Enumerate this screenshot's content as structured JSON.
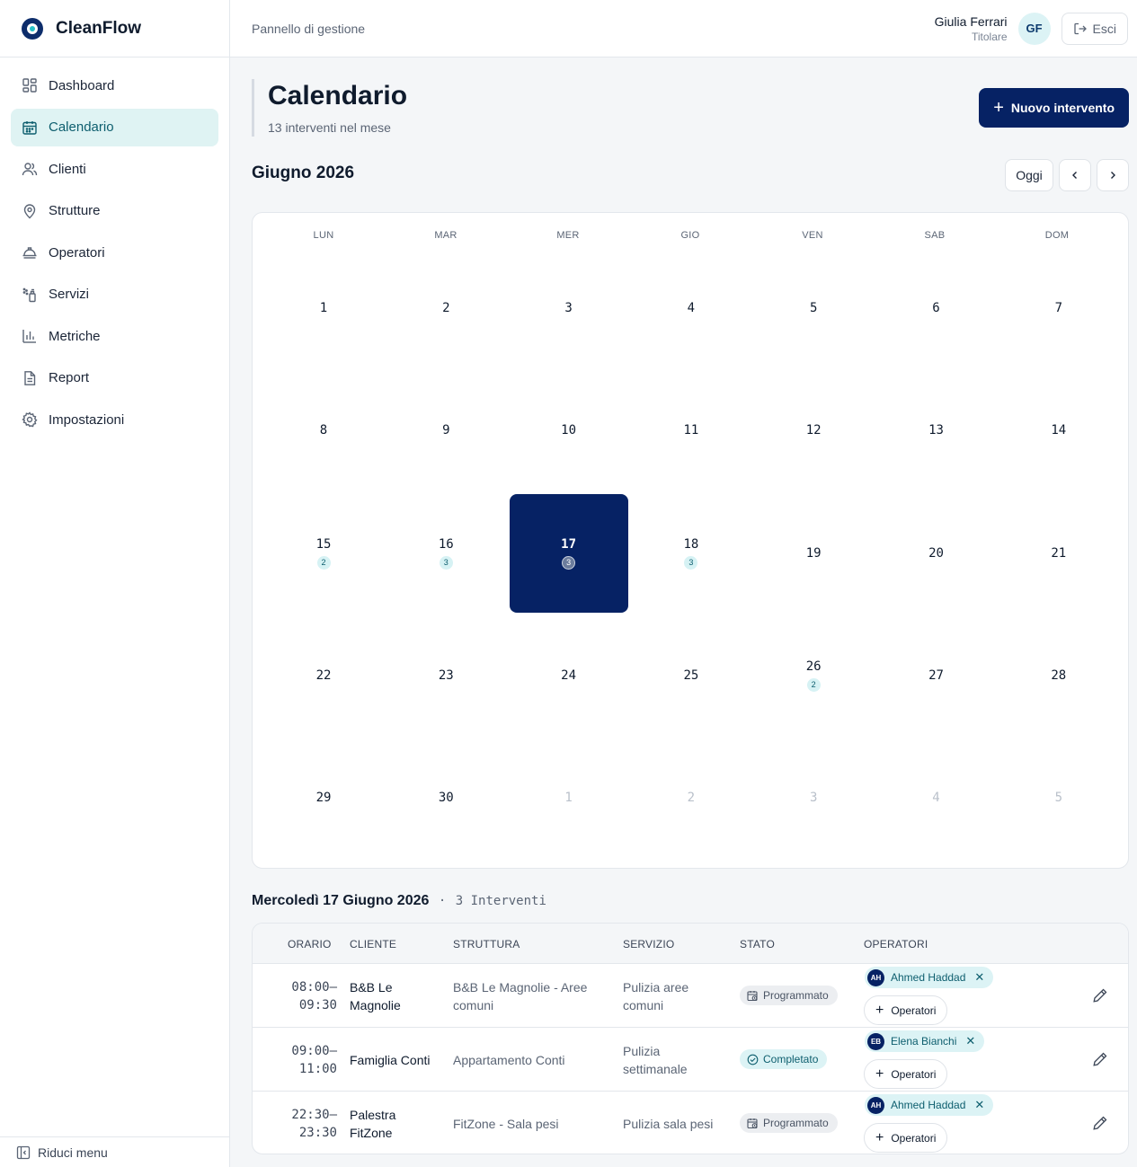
{
  "brand": {
    "name": "CleanFlow"
  },
  "sidebar": {
    "items": [
      {
        "label": "Dashboard",
        "icon": "dashboard-icon"
      },
      {
        "label": "Calendario",
        "icon": "calendar-icon",
        "active": true
      },
      {
        "label": "Clienti",
        "icon": "users-icon"
      },
      {
        "label": "Strutture",
        "icon": "map-pin-icon"
      },
      {
        "label": "Operatori",
        "icon": "helmet-icon"
      },
      {
        "label": "Servizi",
        "icon": "spray-icon"
      },
      {
        "label": "Metriche",
        "icon": "bar-chart-icon"
      },
      {
        "label": "Report",
        "icon": "document-icon"
      },
      {
        "label": "Impostazioni",
        "icon": "gear-icon"
      }
    ],
    "collapse_label": "Riduci menu"
  },
  "topbar": {
    "title": "Pannello di gestione",
    "user_name": "Giulia Ferrari",
    "user_role": "Titolare",
    "user_initials": "GF",
    "logout_label": "Esci"
  },
  "page": {
    "title": "Calendario",
    "subtitle": "13 interventi nel mese",
    "new_button": "Nuovo intervento"
  },
  "calendar": {
    "month_label": "Giugno 2026",
    "today_label": "Oggi",
    "weekdays": [
      "LUN",
      "MAR",
      "MER",
      "GIO",
      "VEN",
      "SAB",
      "DOM"
    ],
    "weeks": [
      [
        {
          "n": "1"
        },
        {
          "n": "2"
        },
        {
          "n": "3"
        },
        {
          "n": "4"
        },
        {
          "n": "5"
        },
        {
          "n": "6"
        },
        {
          "n": "7"
        }
      ],
      [
        {
          "n": "8"
        },
        {
          "n": "9"
        },
        {
          "n": "10"
        },
        {
          "n": "11"
        },
        {
          "n": "12"
        },
        {
          "n": "13"
        },
        {
          "n": "14"
        }
      ],
      [
        {
          "n": "15",
          "count": "2"
        },
        {
          "n": "16",
          "count": "3"
        },
        {
          "n": "17",
          "count": "3",
          "selected": true
        },
        {
          "n": "18",
          "count": "3"
        },
        {
          "n": "19"
        },
        {
          "n": "20"
        },
        {
          "n": "21"
        }
      ],
      [
        {
          "n": "22"
        },
        {
          "n": "23"
        },
        {
          "n": "24"
        },
        {
          "n": "25"
        },
        {
          "n": "26",
          "count": "2"
        },
        {
          "n": "27"
        },
        {
          "n": "28"
        }
      ],
      [
        {
          "n": "29"
        },
        {
          "n": "30"
        },
        {
          "n": "1",
          "muted": true
        },
        {
          "n": "2",
          "muted": true
        },
        {
          "n": "3",
          "muted": true
        },
        {
          "n": "4",
          "muted": true
        },
        {
          "n": "5",
          "muted": true
        }
      ]
    ]
  },
  "day_detail": {
    "title": "Mercoledì 17 Giugno 2026",
    "separator": "·",
    "count_label": "3 Interventi",
    "columns": [
      "ORARIO",
      "CLIENTE",
      "STRUTTURA",
      "SERVIZIO",
      "STATO",
      "OPERATORI"
    ],
    "rows": [
      {
        "time_start": "08:00–",
        "time_end": "09:30",
        "client": "B&B Le Magnolie",
        "structure": "B&B Le Magnolie - Aree comuni",
        "service": "Pulizia aree comuni",
        "status": "Programmato",
        "status_kind": "planned",
        "operator_initials": "AH",
        "operator_name": "Ahmed Haddad",
        "add_label": "Operatori"
      },
      {
        "time_start": "09:00–",
        "time_end": "11:00",
        "client": "Famiglia Conti",
        "structure": "Appartamento Conti",
        "service": "Pulizia settimanale",
        "status": "Completato",
        "status_kind": "done",
        "operator_initials": "EB",
        "operator_name": "Elena Bianchi",
        "add_label": "Operatori"
      },
      {
        "time_start": "22:30–",
        "time_end": "23:30",
        "client": "Palestra FitZone",
        "structure": "FitZone - Sala pesi",
        "service": "Pulizia sala pesi",
        "status": "Programmato",
        "status_kind": "planned",
        "operator_initials": "AH",
        "operator_name": "Ahmed Haddad",
        "add_label": "Operatori"
      }
    ]
  },
  "colors": {
    "primary": "#062264",
    "accent": "#27c1c8",
    "active_bg": "#dff3f3"
  }
}
